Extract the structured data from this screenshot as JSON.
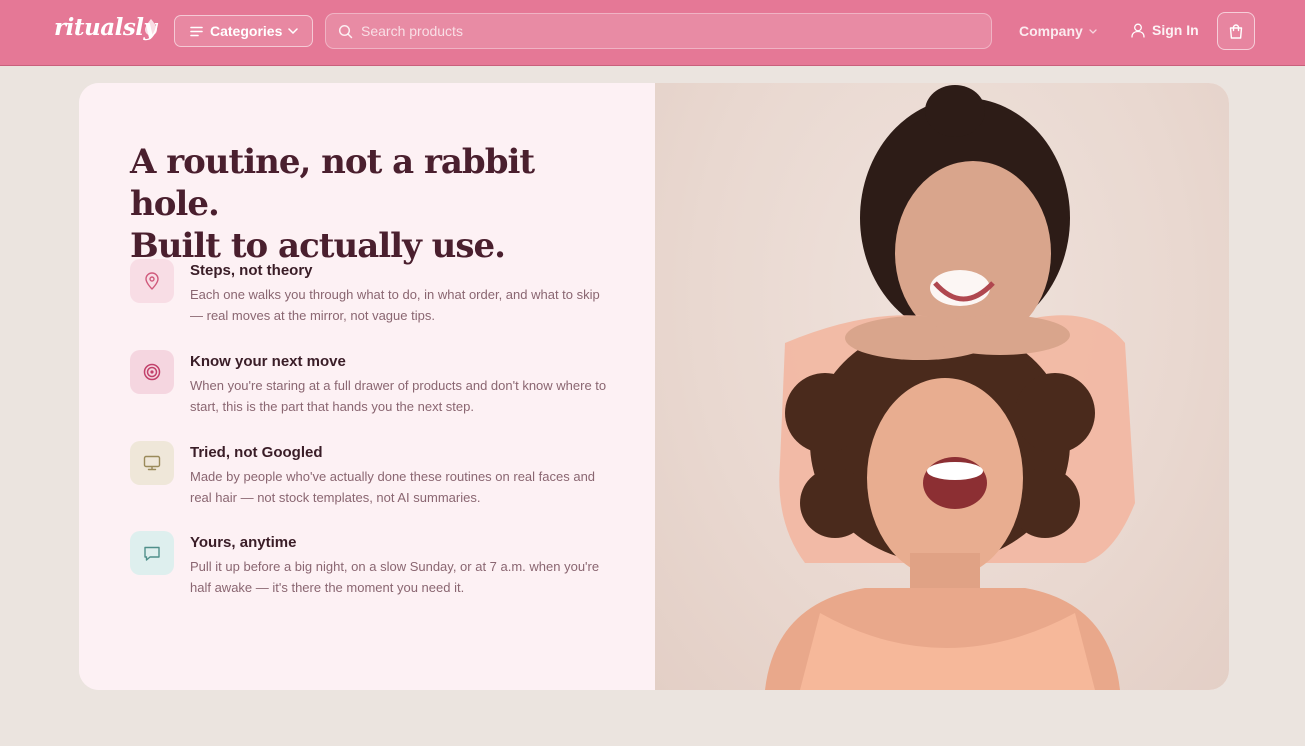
{
  "brand": {
    "name": "ritualsly"
  },
  "nav": {
    "categories_label": "Categories",
    "search_placeholder": "Search products",
    "company_label": "Company",
    "signin_label": "Sign In"
  },
  "hero": {
    "headline_line1": "A routine, not a rabbit hole.",
    "headline_line2": "Built to actually use."
  },
  "features": [
    {
      "icon": "map-pin-icon",
      "title": "Steps, not theory",
      "body": "Each one walks you through what to do, in what order, and what to skip — real moves at the mirror, not vague tips."
    },
    {
      "icon": "target-icon",
      "title": "Know your next move",
      "body": "When you're staring at a full drawer of products and don't know where to start, this is the part that hands you the next step."
    },
    {
      "icon": "monitor-icon",
      "title": "Tried, not Googled",
      "body": "Made by people who've actually done these routines on real faces and real hair — not stock templates, not AI summaries."
    },
    {
      "icon": "chat-bubble-icon",
      "title": "Yours, anytime",
      "body": "Pull it up before a big night, on a slow Sunday, or at 7 a.m. when you're half awake — it's there the moment you need it."
    }
  ],
  "colors": {
    "nav_bg": "#e57896",
    "page_bg": "#ebe4df",
    "card_bg": "#fdf1f4",
    "headline": "#4a1f2e",
    "body_text": "#8a6671"
  }
}
